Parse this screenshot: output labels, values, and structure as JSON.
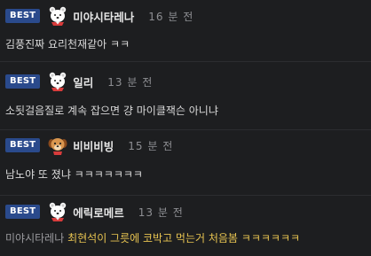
{
  "comments": [
    {
      "badge": "BEST",
      "avatar_icon": "bear-icon",
      "nickname": "미야시타레나",
      "time": "16 분 전",
      "text": "김풍진짜 요리천재같아 ㅋㅋ"
    },
    {
      "badge": "BEST",
      "avatar_icon": "bear-icon",
      "nickname": "일리",
      "time": "13 분 전",
      "text": "소됫걸음질로 계속 잡으면 걍 마이클잭슨 아니냐"
    },
    {
      "badge": "BEST",
      "avatar_icon": "puppy-icon",
      "nickname": "비비비빙",
      "time": "15 분 전",
      "text": "남노야 또 졌냐 ㅋㅋㅋㅋㅋㅋㅋ"
    },
    {
      "badge": "BEST",
      "avatar_icon": "bear-icon",
      "nickname": "에릭로메르",
      "time": "13 분 전",
      "mention": "미야시타레나",
      "text": "최현석이 그릇에 코박고 먹는거 처음봄 ㅋㅋㅋㅋㅋㅋ"
    }
  ],
  "colors": {
    "background": "#1d1e20",
    "badge": "#2a4a8c",
    "highlight": "#e8c451"
  }
}
